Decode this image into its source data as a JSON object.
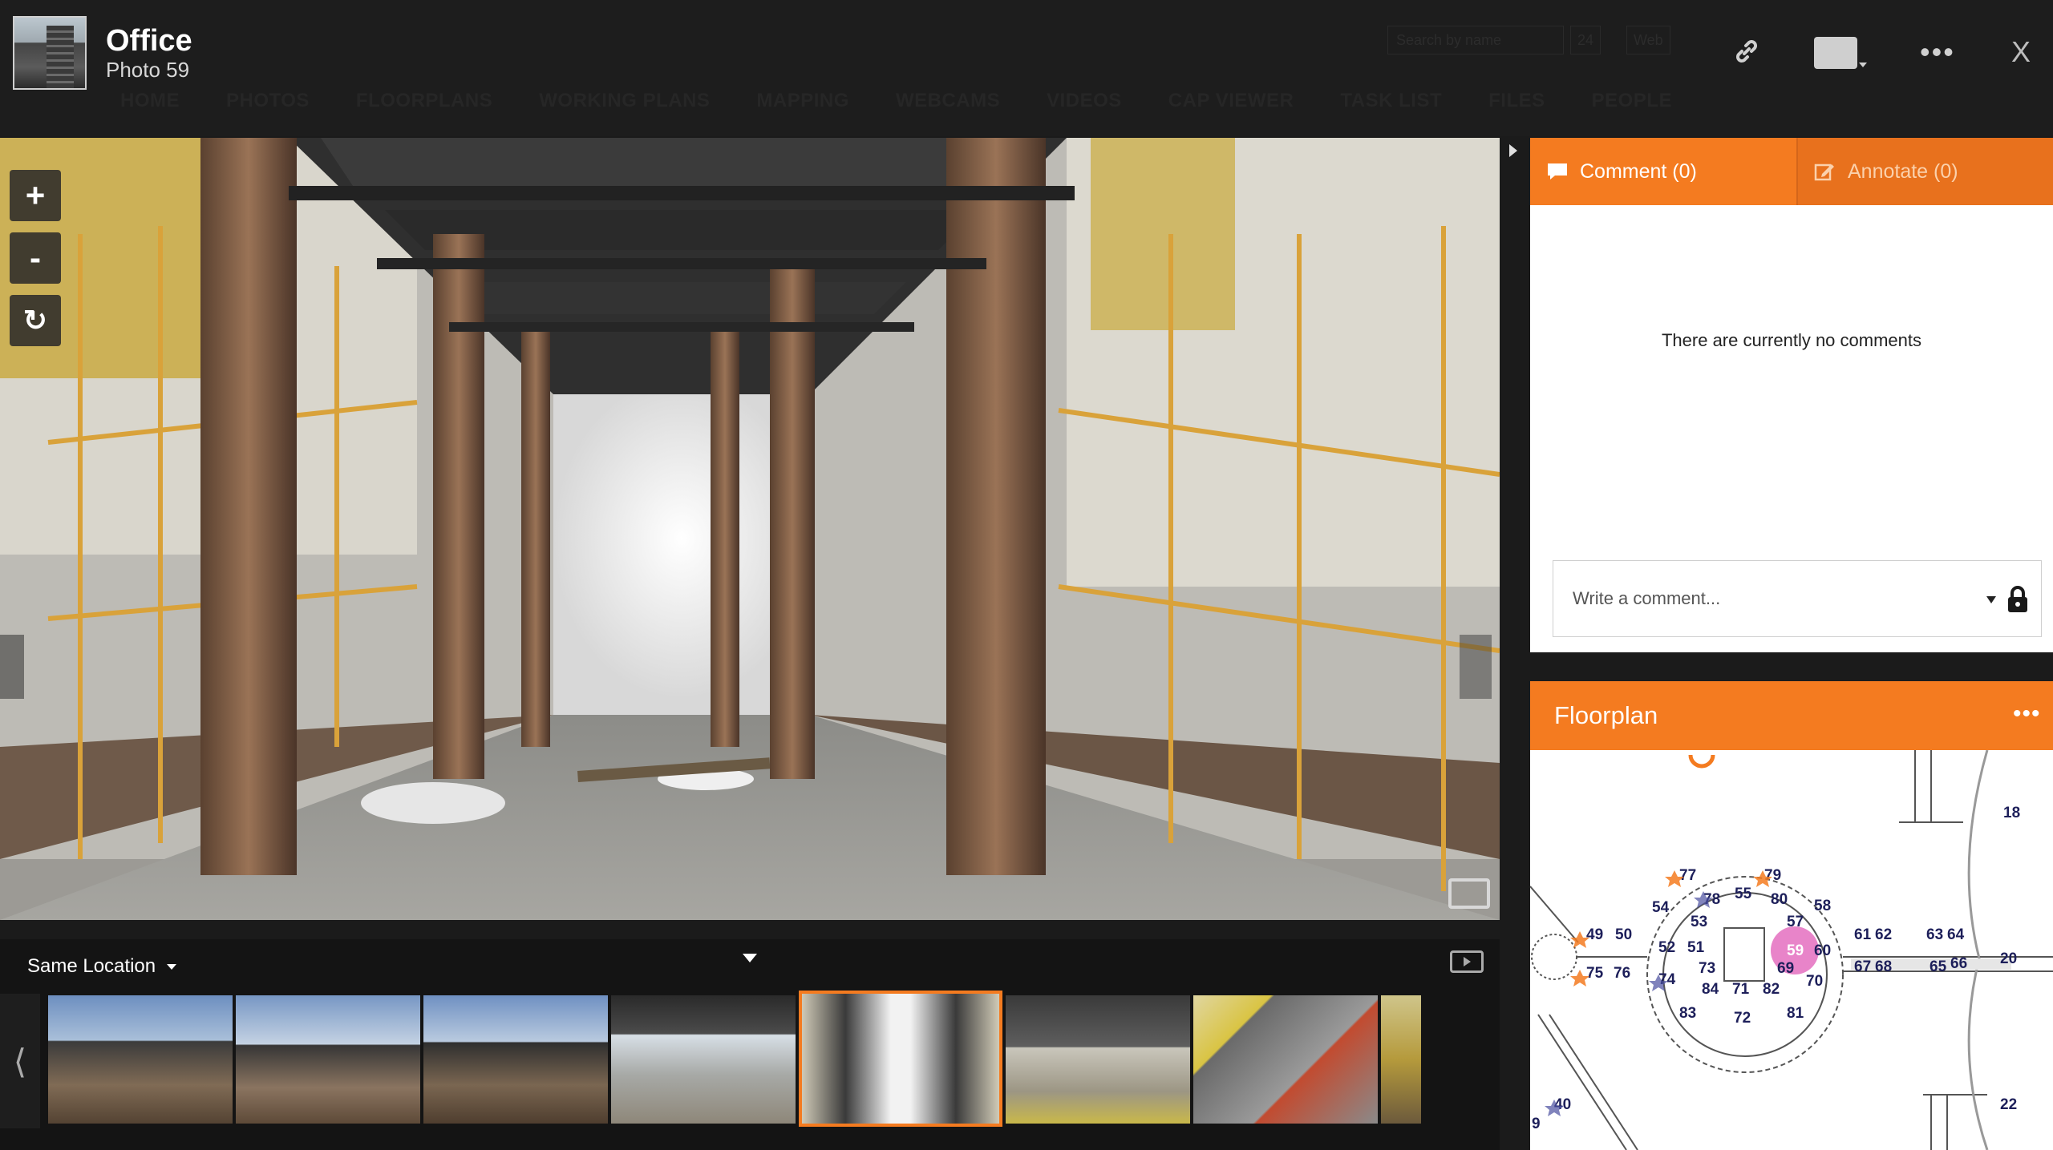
{
  "header": {
    "title": "Office",
    "subtitle": "Photo 59",
    "ghost_search": "Search by name",
    "ghost_buttons": [
      "24",
      "Web"
    ],
    "nav": [
      "HOME",
      "PHOTOS",
      "FLOORPLANS",
      "WORKING PLANS",
      "MAPPING",
      "WEBCAMS",
      "VIDEOS",
      "CAP VIEWER",
      "TASK LIST",
      "FILES",
      "PEOPLE"
    ],
    "close_label": "X"
  },
  "viewer": {
    "zoom_in": "+",
    "zoom_out": "-",
    "rotate": "↻"
  },
  "filmstrip": {
    "location_filter": "Same Location",
    "prev": "⟨"
  },
  "comments": {
    "comment_tab": "Comment (0)",
    "annotate_tab": "Annotate (0)",
    "empty_message": "There are currently no comments",
    "placeholder": "Write a comment..."
  },
  "floorplan": {
    "title": "Floorplan",
    "more": "•••",
    "markers": [
      {
        "n": "77",
        "c": "o"
      },
      {
        "n": "79",
        "c": "o"
      },
      {
        "n": "78",
        "c": "b"
      },
      {
        "n": "55",
        "c": "o"
      },
      {
        "n": "80",
        "c": "b"
      },
      {
        "n": "54",
        "c": "b"
      },
      {
        "n": "58",
        "c": "b"
      },
      {
        "n": "53",
        "c": "o"
      },
      {
        "n": "57",
        "c": "o"
      },
      {
        "n": "49",
        "c": "o"
      },
      {
        "n": "50",
        "c": "o"
      },
      {
        "n": "52",
        "c": "b"
      },
      {
        "n": "51",
        "c": "o"
      },
      {
        "n": "59",
        "c": "p"
      },
      {
        "n": "60",
        "c": "b"
      },
      {
        "n": "61",
        "c": "o"
      },
      {
        "n": "62",
        "c": "b"
      },
      {
        "n": "63",
        "c": "o"
      },
      {
        "n": "64",
        "c": "b"
      },
      {
        "n": "73",
        "c": "o"
      },
      {
        "n": "69",
        "c": "o"
      },
      {
        "n": "67",
        "c": "o"
      },
      {
        "n": "68",
        "c": "b"
      },
      {
        "n": "65",
        "c": "o"
      },
      {
        "n": "66",
        "c": "b"
      },
      {
        "n": "75",
        "c": "o"
      },
      {
        "n": "76",
        "c": "b"
      },
      {
        "n": "74",
        "c": "b"
      },
      {
        "n": "84",
        "c": "b"
      },
      {
        "n": "71",
        "c": "o"
      },
      {
        "n": "82",
        "c": "b"
      },
      {
        "n": "70",
        "c": "b"
      },
      {
        "n": "83",
        "c": "o"
      },
      {
        "n": "72",
        "c": "b"
      },
      {
        "n": "81",
        "c": "o"
      },
      {
        "n": "18",
        "c": "b"
      },
      {
        "n": "20",
        "c": "b"
      },
      {
        "n": "22",
        "c": "b"
      },
      {
        "n": "40",
        "c": "b"
      },
      {
        "n": "9",
        "c": "o"
      }
    ]
  },
  "colors": {
    "accent": "#f47b20",
    "marker_orange": "#f47b20",
    "marker_blue": "#4a4fa0",
    "marker_current": "#e05bb7"
  }
}
